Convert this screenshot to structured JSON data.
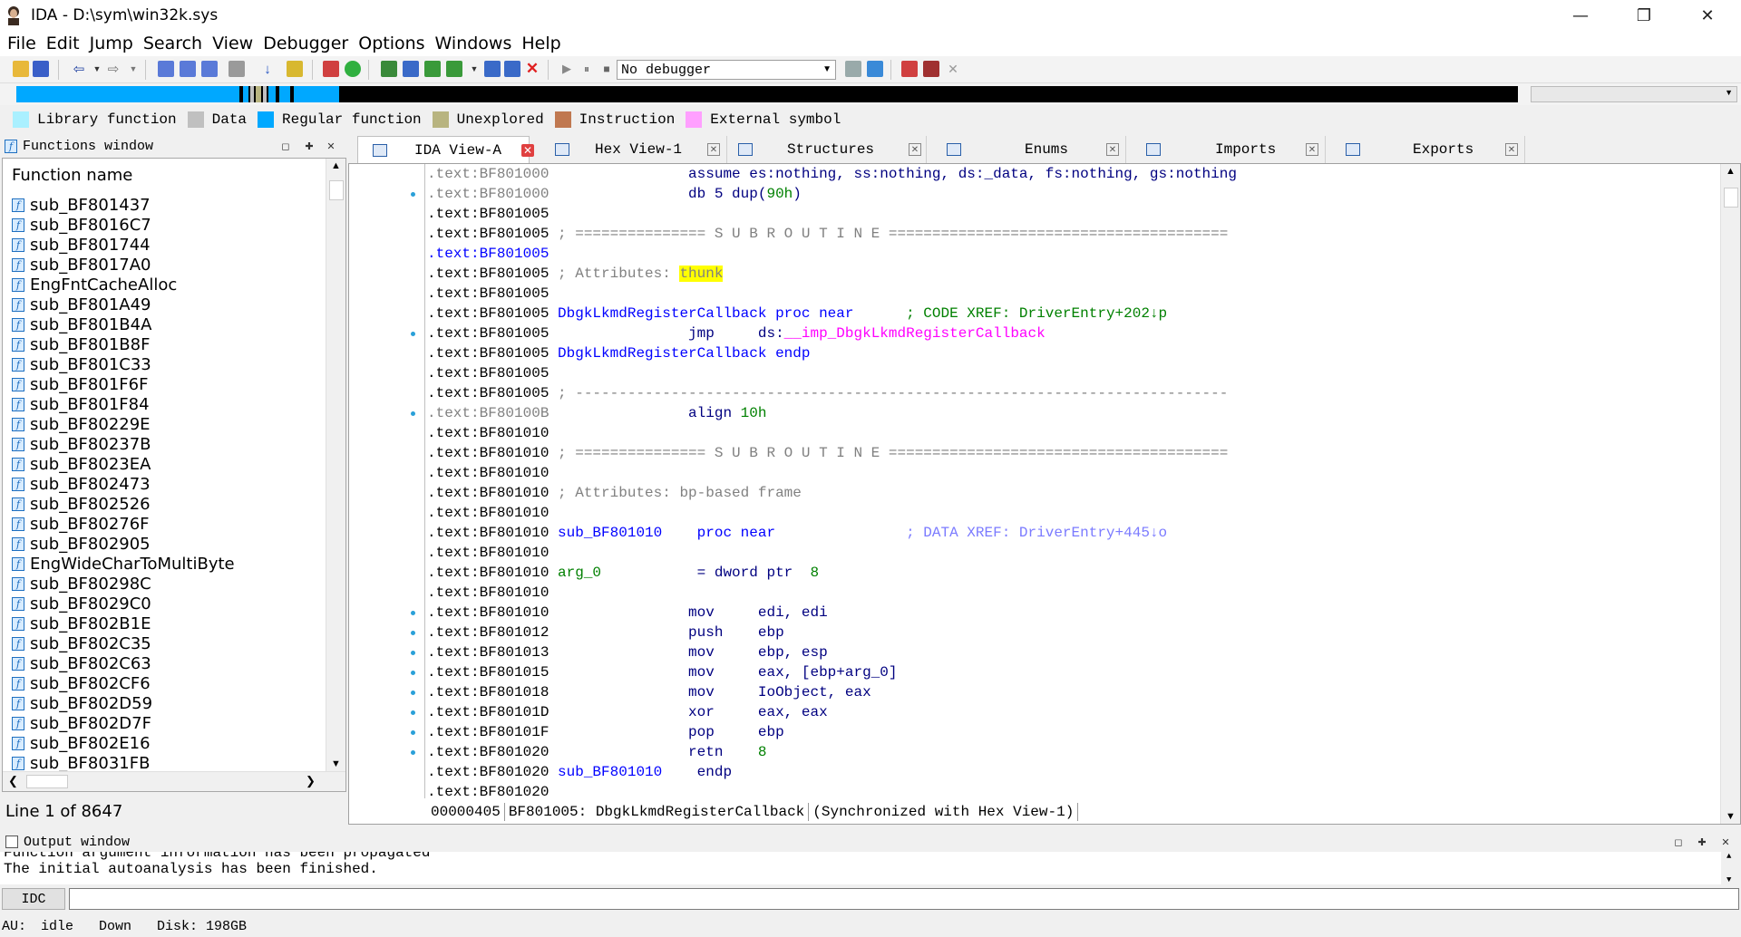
{
  "window": {
    "title": "IDA - D:\\sym\\win32k.sys",
    "minimize_glyph": "—",
    "maximize_glyph": "❐",
    "close_glyph": "✕"
  },
  "menu": [
    "File",
    "Edit",
    "Jump",
    "Search",
    "View",
    "Debugger",
    "Options",
    "Windows",
    "Help"
  ],
  "toolbar": {
    "debugger_value": "No debugger",
    "icons": [
      "open-icon",
      "save-icon",
      "back-icon",
      "forward-icon",
      "search-icon",
      "graph-icon",
      "run-icon",
      "pause-icon",
      "stop-icon",
      "close-icon"
    ]
  },
  "legend": [
    {
      "label": "Library function",
      "color": "#aaf0ff"
    },
    {
      "label": "Data",
      "color": "#c0c0c0"
    },
    {
      "label": "Regular function",
      "color": "#00a8ff"
    },
    {
      "label": "Unexplored",
      "color": "#b8b480"
    },
    {
      "label": "Instruction",
      "color": "#c07850"
    },
    {
      "label": "External symbol",
      "color": "#ffa0ff"
    }
  ],
  "functions_window": {
    "title": "Functions window",
    "column_header": "Function name",
    "items": [
      "sub_BF801437",
      "sub_BF8016C7",
      "sub_BF801744",
      "sub_BF8017A0",
      "EngFntCacheAlloc",
      "sub_BF801A49",
      "sub_BF801B4A",
      "sub_BF801B8F",
      "sub_BF801C33",
      "sub_BF801F6F",
      "sub_BF801F84",
      "sub_BF80229E",
      "sub_BF80237B",
      "sub_BF8023EA",
      "sub_BF802473",
      "sub_BF802526",
      "sub_BF80276F",
      "sub_BF802905",
      "EngWideCharToMultiByte",
      "sub_BF80298C",
      "sub_BF8029C0",
      "sub_BF802B1E",
      "sub_BF802C35",
      "sub_BF802C63",
      "sub_BF802CF6",
      "sub_BF802D59",
      "sub_BF802D7F",
      "sub_BF802E16",
      "sub_BF8031FB"
    ],
    "status": "Line 1 of 8647"
  },
  "tabs": [
    {
      "label": "IDA View-A",
      "active": true
    },
    {
      "label": "Hex View-1",
      "active": false
    },
    {
      "label": "Structures",
      "active": false
    },
    {
      "label": "Enums",
      "active": false
    },
    {
      "label": "Imports",
      "active": false
    },
    {
      "label": "Exports",
      "active": false
    }
  ],
  "disasm": {
    "lines": [
      {
        "addr": ".text:BF801000",
        "addr_style": "dim",
        "dot": false,
        "parts": [
          {
            "t": "                assume es:nothing, ss:nothing, ds:_data, fs:nothing, gs:nothing",
            "c": "c-navy"
          }
        ]
      },
      {
        "addr": ".text:BF801000",
        "addr_style": "dim",
        "dot": true,
        "parts": [
          {
            "t": "                db 5 dup(",
            "c": "c-navy"
          },
          {
            "t": "90h",
            "c": "c-green"
          },
          {
            "t": ")",
            "c": "c-navy"
          }
        ]
      },
      {
        "addr": ".text:BF801005",
        "addr_style": "",
        "dot": false,
        "parts": []
      },
      {
        "addr": ".text:BF801005",
        "addr_style": "",
        "dot": false,
        "parts": [
          {
            "t": " ; =============== S U B R O U T I N E =======================================",
            "c": "c-gray"
          }
        ]
      },
      {
        "addr": ".text:BF801005",
        "addr_style": "hl",
        "dot": false,
        "parts": []
      },
      {
        "addr": ".text:BF801005",
        "addr_style": "",
        "dot": false,
        "parts": [
          {
            "t": " ; Attributes: ",
            "c": "c-gray"
          },
          {
            "t": "thunk",
            "c": "yellow-hl"
          }
        ]
      },
      {
        "addr": ".text:BF801005",
        "addr_style": "",
        "dot": false,
        "parts": []
      },
      {
        "addr": ".text:BF801005",
        "addr_style": "",
        "dot": false,
        "parts": [
          {
            "t": " DbgkLkmdRegisterCallback proc near      ",
            "c": "c-blue"
          },
          {
            "t": "; CODE XREF: ",
            "c": "c-green"
          },
          {
            "t": "DriverEntry+202↓p",
            "c": "c-green"
          }
        ]
      },
      {
        "addr": ".text:BF801005",
        "addr_style": "",
        "dot": true,
        "parts": [
          {
            "t": "                jmp     ds:",
            "c": "c-navy"
          },
          {
            "t": "__imp_DbgkLkmdRegisterCallback",
            "c": "c-magenta"
          }
        ]
      },
      {
        "addr": ".text:BF801005",
        "addr_style": "",
        "dot": false,
        "parts": [
          {
            "t": " DbgkLkmdRegisterCallback endp",
            "c": "c-blue"
          }
        ]
      },
      {
        "addr": ".text:BF801005",
        "addr_style": "",
        "dot": false,
        "parts": []
      },
      {
        "addr": ".text:BF801005",
        "addr_style": "",
        "dot": false,
        "parts": [
          {
            "t": " ; ---------------------------------------------------------------------------",
            "c": "c-gray"
          }
        ]
      },
      {
        "addr": ".text:BF80100B",
        "addr_style": "dim",
        "dot": true,
        "parts": [
          {
            "t": "                align ",
            "c": "c-navy"
          },
          {
            "t": "10h",
            "c": "c-green"
          }
        ]
      },
      {
        "addr": ".text:BF801010",
        "addr_style": "",
        "dot": false,
        "parts": []
      },
      {
        "addr": ".text:BF801010",
        "addr_style": "",
        "dot": false,
        "parts": [
          {
            "t": " ; =============== S U B R O U T I N E =======================================",
            "c": "c-gray"
          }
        ]
      },
      {
        "addr": ".text:BF801010",
        "addr_style": "",
        "dot": false,
        "parts": []
      },
      {
        "addr": ".text:BF801010",
        "addr_style": "",
        "dot": false,
        "parts": [
          {
            "t": " ; Attributes: bp-based frame",
            "c": "c-gray"
          }
        ]
      },
      {
        "addr": ".text:BF801010",
        "addr_style": "",
        "dot": false,
        "parts": []
      },
      {
        "addr": ".text:BF801010",
        "addr_style": "",
        "dot": false,
        "parts": [
          {
            "t": " sub_BF801010    proc near               ",
            "c": "c-blue"
          },
          {
            "t": "; DATA XREF: DriverEntry+445↓o",
            "c": "c-lightblue"
          }
        ]
      },
      {
        "addr": ".text:BF801010",
        "addr_style": "",
        "dot": false,
        "parts": []
      },
      {
        "addr": ".text:BF801010",
        "addr_style": "",
        "dot": false,
        "parts": [
          {
            "t": " arg_0",
            "c": "c-green"
          },
          {
            "t": "           = dword ptr  ",
            "c": "c-navy"
          },
          {
            "t": "8",
            "c": "c-green"
          }
        ]
      },
      {
        "addr": ".text:BF801010",
        "addr_style": "",
        "dot": false,
        "parts": []
      },
      {
        "addr": ".text:BF801010",
        "addr_style": "",
        "dot": true,
        "parts": [
          {
            "t": "                mov     edi, edi",
            "c": "c-navy"
          }
        ]
      },
      {
        "addr": ".text:BF801012",
        "addr_style": "",
        "dot": true,
        "parts": [
          {
            "t": "                push    ebp",
            "c": "c-navy"
          }
        ]
      },
      {
        "addr": ".text:BF801013",
        "addr_style": "",
        "dot": true,
        "parts": [
          {
            "t": "                mov     ebp, esp",
            "c": "c-navy"
          }
        ]
      },
      {
        "addr": ".text:BF801015",
        "addr_style": "",
        "dot": true,
        "parts": [
          {
            "t": "                mov     eax, [ebp+arg_0]",
            "c": "c-navy"
          }
        ]
      },
      {
        "addr": ".text:BF801018",
        "addr_style": "",
        "dot": true,
        "parts": [
          {
            "t": "                mov     IoObject, eax",
            "c": "c-navy"
          }
        ]
      },
      {
        "addr": ".text:BF80101D",
        "addr_style": "",
        "dot": true,
        "parts": [
          {
            "t": "                xor     eax, eax",
            "c": "c-navy"
          }
        ]
      },
      {
        "addr": ".text:BF80101F",
        "addr_style": "",
        "dot": true,
        "parts": [
          {
            "t": "                pop     ebp",
            "c": "c-navy"
          }
        ]
      },
      {
        "addr": ".text:BF801020",
        "addr_style": "",
        "dot": true,
        "parts": [
          {
            "t": "                retn    ",
            "c": "c-navy"
          },
          {
            "t": "8",
            "c": "c-green"
          }
        ]
      },
      {
        "addr": ".text:BF801020",
        "addr_style": "",
        "dot": false,
        "parts": [
          {
            "t": " sub_BF801010    ",
            "c": "c-blue"
          },
          {
            "t": "endp",
            "c": "c-navy"
          }
        ]
      },
      {
        "addr": ".text:BF801020",
        "addr_style": "",
        "dot": false,
        "parts": []
      }
    ],
    "status": {
      "offset": "00000405",
      "location": "BF801005: DbgkLkmdRegisterCallback",
      "sync": "(Synchronized with Hex View-1)"
    }
  },
  "output_window": {
    "title": "Output window",
    "lines": [
      "Function argument information has been propagated",
      "The initial autoanalysis has been finished."
    ],
    "idc_label": "IDC"
  },
  "statusbar": {
    "au_label": "AU:",
    "au_state": "idle",
    "direction": "Down",
    "disk": "Disk: 198GB"
  }
}
